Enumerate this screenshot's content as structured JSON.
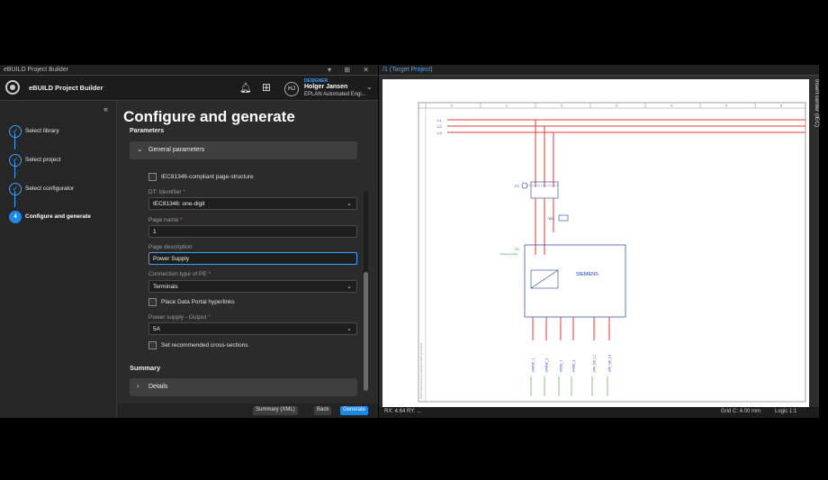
{
  "left_window": {
    "title": "eBUILD Project Builder",
    "controls": [
      "▾",
      "⊞",
      "✕"
    ]
  },
  "app_header": {
    "app_name": "eBUILD Project Builder",
    "user_role": "DESIGNER",
    "user_name": "Holger Jansen",
    "user_company": "EPLAN Automated Engi...",
    "avatar_initials": "HJ"
  },
  "stepper": {
    "collapse_glyph": "«",
    "steps": [
      {
        "label": "Select library",
        "state": "done",
        "glyph": "✓"
      },
      {
        "label": "Select project",
        "state": "done",
        "glyph": "✓"
      },
      {
        "label": "Select configurator",
        "state": "done",
        "glyph": "✓"
      },
      {
        "label": "Configure and generate",
        "state": "active",
        "glyph": "4"
      }
    ]
  },
  "main": {
    "title": "Configure and generate",
    "parameters_heading": "Parameters",
    "general_section": "General parameters",
    "iec_checkbox": "IEC81346-compliant page-structure",
    "dt_identifier": {
      "label": "DT: Identifier",
      "value": "IEC81346: one-digit"
    },
    "page_name": {
      "label": "Page name",
      "value": "1"
    },
    "page_description": {
      "label": "Page description",
      "value": "Power Supply"
    },
    "connection_pe": {
      "label": "Connection type of PE",
      "value": "Terminals"
    },
    "portal_checkbox": "Place Data Portal hyperlinks",
    "power_supply": {
      "label": "Power supply - Output",
      "value": "5A"
    },
    "cross_checkbox": "Set recommended cross-sections",
    "summary_heading": "Summary",
    "details_section": "Details",
    "required_mark": "*"
  },
  "footer": {
    "summary_button": "Summary (XML)",
    "back_button": "Back",
    "generate_button": "Generate"
  },
  "right_window": {
    "title": "/1 (Target Project)",
    "side_tab": "Insert center (IEC)",
    "status_rx": "RX: 4.64 RY: ...",
    "status_grid": "Grid C: 4.00 mm",
    "status_logic": "Logic 1:1"
  },
  "schematic": {
    "column_numbers": [
      "0",
      "1",
      "2",
      "3",
      "4",
      "5",
      "6"
    ],
    "rail_labels": [
      "-L1",
      "-L2",
      "-L3"
    ],
    "device_q1": "-F1",
    "device_w1": "-W1",
    "device_t1": "-T1",
    "brand": "SIEMENS",
    "output_labels": [
      "-24VDC_1",
      "-24VDC_2",
      "-0VDC_1",
      "-0VDC_2",
      "-24V_DC_L1",
      "-24V_DC_L4"
    ],
    "colors": {
      "phase": "#e53935",
      "device": "#1a3fa8",
      "green": "#3a9a3a",
      "frame": "#555555"
    }
  }
}
